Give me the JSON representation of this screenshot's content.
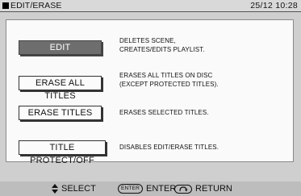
{
  "header": {
    "title": "EDIT/ERASE",
    "clock": "25/12 10:28"
  },
  "menu": {
    "items": [
      {
        "label": "EDIT",
        "desc_line1": "DELETES SCENE,",
        "desc_line2": "CREATES/EDITS PLAYLIST."
      },
      {
        "label": "ERASE ALL TITLES",
        "desc_line1": "ERASES ALL TITLES ON DISC",
        "desc_line2": "(EXCEPT PROTECTED TITLES)."
      },
      {
        "label": "ERASE TITLES",
        "desc_line1": "ERASES SELECTED TITLES.",
        "desc_line2": ""
      },
      {
        "label": "TITLE PROTECT/OFF",
        "desc_line1": "DISABLES EDIT/ERASE TITLES.",
        "desc_line2": ""
      }
    ]
  },
  "helpbar": {
    "select_label": "SELECT",
    "enter_icon_text": "ENTER",
    "enter_label": "ENTER",
    "return_label": "RETURN"
  },
  "colors": {
    "selected_bg": "#6e6e6e",
    "panel_bg": "#fafafa",
    "frame_bg": "#cfcfcf"
  }
}
